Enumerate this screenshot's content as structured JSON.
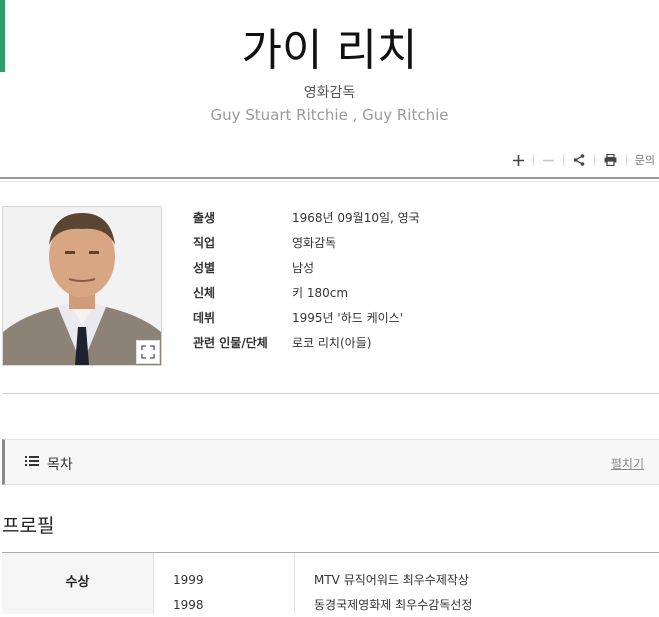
{
  "header": {
    "title": "가이 리치",
    "subtitle": "영화감독",
    "english_name": "Guy Stuart Ritchie , Guy Ritchie"
  },
  "toolbar": {
    "plus_icon": "plus-icon",
    "minus_icon": "minus-icon",
    "share_icon": "share-icon",
    "print_icon": "print-icon",
    "inquiry_label": "문의"
  },
  "info": {
    "rows": [
      {
        "label": "출생",
        "value": "1968년 09월10일, 영국"
      },
      {
        "label": "직업",
        "value": "영화감독"
      },
      {
        "label": "성별",
        "value": "남성"
      },
      {
        "label": "신체",
        "value": "키 180cm"
      },
      {
        "label": "데뷔",
        "value": "1995년 '하드 케이스'"
      },
      {
        "label": "관련 인물/단체",
        "value": "로코 리치(아들)"
      }
    ]
  },
  "toc": {
    "label": "목차",
    "expand_label": "펼치기"
  },
  "profile": {
    "title": "프로필",
    "awards_header": "수상",
    "awards": [
      {
        "year": "1999",
        "desc": "MTV 뮤직어워드 최우수제작상"
      },
      {
        "year": "1998",
        "desc": "동경국제영화제 최우수감독선정"
      }
    ]
  },
  "colors": {
    "accent_green": "#2c9e6a"
  }
}
